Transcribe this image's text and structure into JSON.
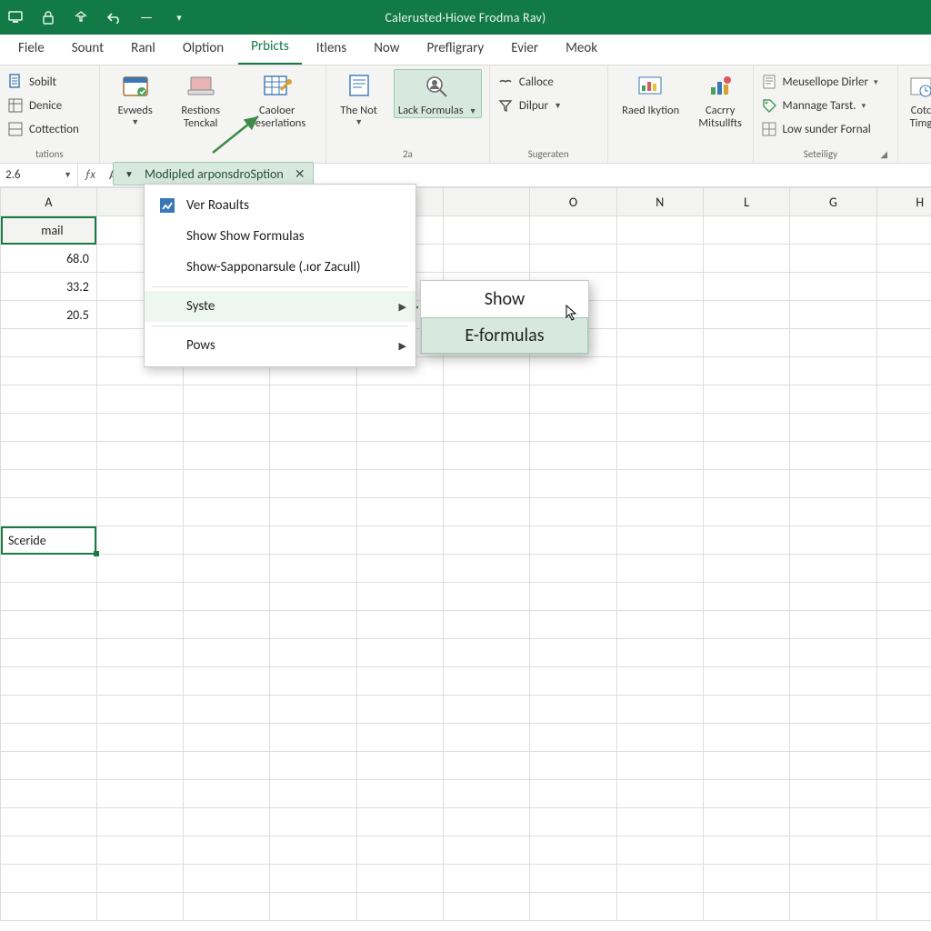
{
  "colors": {
    "brand": "#127a47",
    "highlight": "#d7e9de",
    "highlightBorder": "#9fc9b1"
  },
  "titlebar": {
    "title": "Calerusted·Hiove Frodma Rav)",
    "qat": [
      "monitor-icon",
      "lock-icon",
      "sigma-icon",
      "undo-icon",
      "minus-icon",
      "caret-icon"
    ]
  },
  "tabs": [
    "Fiele",
    "Sount",
    "Ranl",
    "Olption",
    "Prbicts",
    "Itlens",
    "Now",
    "Prefligrary",
    "Evier",
    "Meok"
  ],
  "activeTab": "Prbicts",
  "ribbon": {
    "group0": {
      "label": "tations",
      "items": [
        "Sobilt",
        "Denice",
        "Cottection"
      ]
    },
    "group1": {
      "label": "",
      "btn1": "Evweds",
      "btn2a": "Restions",
      "btn2b": "Tenckal",
      "btn3a": "Caoloer",
      "btn3b": "Deserlations"
    },
    "group2": {
      "label": "2a",
      "btn1": "The Not",
      "btn2": "Lack Formulas"
    },
    "group3": {
      "label": "Sugeraten",
      "row1": "Calloce",
      "row2": "Dilpur"
    },
    "group4": {
      "label": "",
      "btn1": "Raed Ikytion",
      "btn2a": "Cacrry",
      "btn2b": "Mitsullfts"
    },
    "group5": {
      "label": "Seteiligy",
      "row1": "Meusellope Dirler",
      "row2": "Mannage Tarst.",
      "row3": "Low sunder Fornal"
    },
    "group6": {
      "btn1a": "Cotc",
      "btn1b": "Timg"
    }
  },
  "splitDropdown": {
    "label": "Modipled arponsdroSption"
  },
  "namebox": "2.6",
  "formula_prefix": "A",
  "columns": [
    "A",
    "",
    "",
    "",
    "",
    "",
    "O",
    "N",
    "L",
    "G",
    "H"
  ],
  "colA_header_sub": "mail",
  "cells": {
    "A2": "68.0",
    "A3": "33.2",
    "A4": "20.5",
    "A12": "Sceride"
  },
  "menu": {
    "items": [
      {
        "icon": true,
        "label": "Ver Roaults"
      },
      {
        "icon": false,
        "label": "Show Show Formulas"
      },
      {
        "icon": false,
        "label": "Show-Sapponarsule (.ıor Zacull)"
      }
    ],
    "subparents": [
      {
        "label": "Syste"
      },
      {
        "label": "Pows"
      }
    ]
  },
  "submenu": {
    "line1": "Show",
    "line2": "E-formulas"
  }
}
